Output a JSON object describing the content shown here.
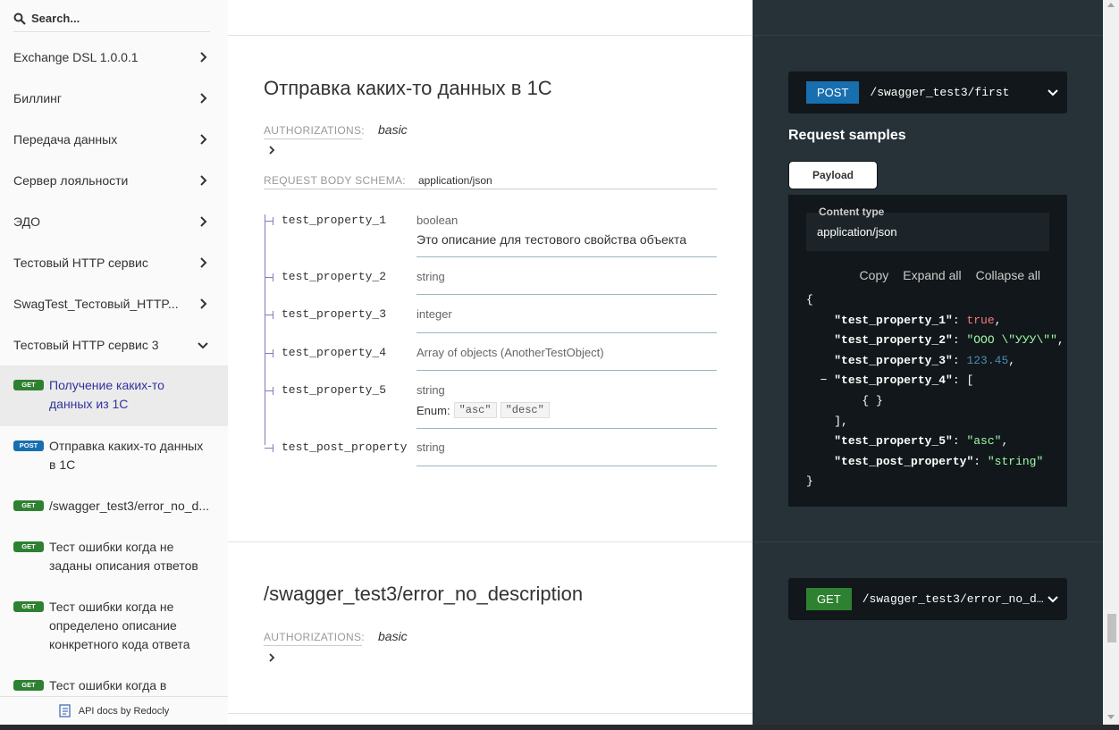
{
  "search": {
    "placeholder": "Search..."
  },
  "sidebar": {
    "groups": [
      {
        "label": "Exchange DSL 1.0.0.1"
      },
      {
        "label": "Биллинг"
      },
      {
        "label": "Передача данных"
      },
      {
        "label": "Сервер лояльности"
      },
      {
        "label": "ЭДО"
      },
      {
        "label": "Тестовый HTTP сервис"
      },
      {
        "label": "SwagTest_Тестовый_HTTP..."
      },
      {
        "label": "Тестовый HTTP сервис 3"
      }
    ],
    "operations": [
      {
        "method": "GET",
        "label": "Получение каких-то данных из 1С"
      },
      {
        "method": "POST",
        "label": "Отправка каких-то данных в 1С"
      },
      {
        "method": "GET",
        "label": "/swagger_test3/error_no_d..."
      },
      {
        "method": "GET",
        "label": "Тест ошибки когда не заданы описания ответов"
      },
      {
        "method": "GET",
        "label": "Тест ошибки когда не определено описание конкретного кода ответа"
      },
      {
        "method": "GET",
        "label": "Тест ошибки когда в"
      }
    ],
    "footer": "API docs by Redocly"
  },
  "operation1": {
    "title": "Отправка каких-то данных в 1С",
    "auth_label": "AUTHORIZATIONS:",
    "auth_value": "basic",
    "schema_label": "REQUEST BODY SCHEMA:",
    "schema_value": "application/json",
    "properties": [
      {
        "name": "test_property_1",
        "type": "boolean",
        "description": "Это описание для тестового свойства объекта"
      },
      {
        "name": "test_property_2",
        "type": "string"
      },
      {
        "name": "test_property_3",
        "type": "integer"
      },
      {
        "name": "test_property_4",
        "type": "Array of objects (AnotherTestObject)"
      },
      {
        "name": "test_property_5",
        "type": "string",
        "enum_label": "Enum:",
        "enum": [
          "\"asc\"",
          "\"desc\""
        ]
      },
      {
        "name": "test_post_property",
        "type": "string"
      }
    ]
  },
  "operation2": {
    "title": "/swagger_test3/error_no_description",
    "auth_label": "AUTHORIZATIONS:",
    "auth_value": "basic"
  },
  "right": {
    "endpoint1": {
      "method": "POST",
      "path": "/swagger_test3/first"
    },
    "request_samples": "Request samples",
    "payload_tab": "Payload",
    "content_type_label": "Content type",
    "content_type_value": "application/json",
    "actions": {
      "copy": "Copy",
      "expand": "Expand all",
      "collapse": "Collapse all"
    },
    "endpoint2": {
      "method": "GET",
      "path": "/swagger_test3/error_no_d..."
    }
  },
  "code": {
    "open": "{",
    "k1": "\"test_property_1\"",
    "v1": "true",
    "k2": "\"test_property_2\"",
    "v2": "\"ООО \\\"УУУ\\\"\"",
    "k3": "\"test_property_3\"",
    "v3": "123.45",
    "k4": "\"test_property_4\"",
    "v4": "[",
    "inner": "{ }",
    "close_arr": "],",
    "k5": "\"test_property_5\"",
    "v5": "\"asc\"",
    "k6": "\"test_post_property\"",
    "v6": "\"string\"",
    "close": "}",
    "toggle": "−"
  },
  "colors": {
    "get": "#2f8132",
    "post": "#186faf",
    "dark_panel": "#263238"
  }
}
